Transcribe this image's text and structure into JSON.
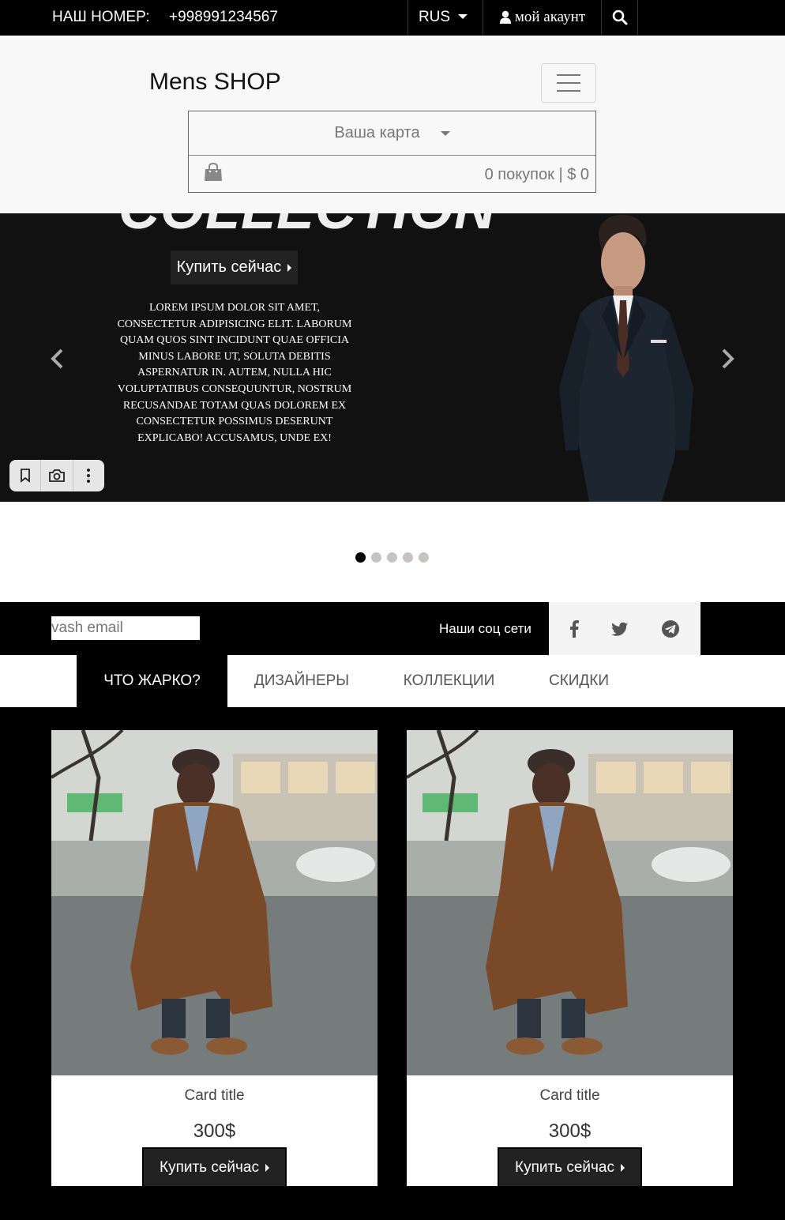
{
  "topbar": {
    "phone_label": "НАШ НОМЕР:",
    "phone_number": "+998991234567",
    "language": "RUS",
    "account_label": "мой акаунт"
  },
  "header": {
    "brand": "Mens SHOP",
    "cart_label": "Ваша карта",
    "cart_summary": "0 покупок | $ 0"
  },
  "hero": {
    "heading": "COLLECTION",
    "buy_label": "Купить сейчас",
    "text": "Lorem ipsum dolor sit amet, consectetur adipisicing elit. Laborum quam quos sint incidunt quae officia minus labore ut, soluta debitis aspernatur in. Autem, nulla hic voluptatibus consequuntur, nostrum recusandae totam quas dolorem ex consectetur possimus deserunt explicabo! Accusamus, unde ex!",
    "slides_count": 5,
    "active_slide": 1
  },
  "subscribe": {
    "email_placeholder": "vash email",
    "social_label": "Наши соц сети",
    "social_icons": [
      "facebook-icon",
      "twitter-icon",
      "telegram-icon"
    ]
  },
  "tabs": [
    {
      "label": "ЧТО ЖАРКО?",
      "active": true
    },
    {
      "label": "ДИЗАЙНЕРЫ",
      "active": false
    },
    {
      "label": "КОЛЛЕКЦИИ",
      "active": false
    },
    {
      "label": "СКИДКИ",
      "active": false
    }
  ],
  "products": [
    {
      "title": "Card title",
      "price": "300$",
      "buy_label": "Купить сейчас"
    },
    {
      "title": "Card title",
      "price": "300$",
      "buy_label": "Купить сейчас"
    }
  ],
  "colors": {
    "topbar_bg": "#000000",
    "header_bg": "#f8f8f8",
    "hero_bg": "#121111",
    "button_bg": "#222222",
    "coat_brown": "#7a4a28"
  }
}
